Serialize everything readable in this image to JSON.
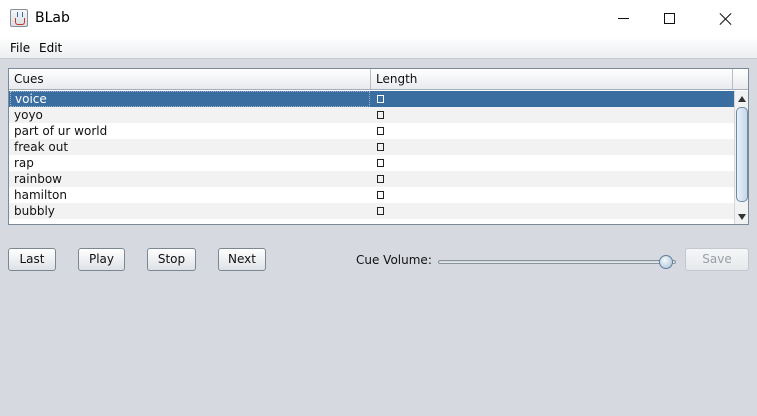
{
  "window": {
    "title": "BLab",
    "icon": "java-cup-icon"
  },
  "menubar": {
    "items": [
      "File",
      "Edit"
    ]
  },
  "table": {
    "columns": [
      "Cues",
      "Length"
    ],
    "length_glyph": "□",
    "selected_index": 0,
    "rows": [
      {
        "cue": "voice"
      },
      {
        "cue": "yoyo"
      },
      {
        "cue": "part of ur world"
      },
      {
        "cue": "freak out"
      },
      {
        "cue": "rap"
      },
      {
        "cue": "rainbow"
      },
      {
        "cue": "hamilton"
      },
      {
        "cue": "bubbly"
      }
    ]
  },
  "controls": {
    "last": "Last",
    "play": "Play",
    "stop": "Stop",
    "next": "Next",
    "volume_label": "Cue Volume:",
    "volume_level": 0.97,
    "save": "Save",
    "save_enabled": false
  },
  "colors": {
    "selection": "#3a6ea0",
    "background": "#d6d9df"
  }
}
